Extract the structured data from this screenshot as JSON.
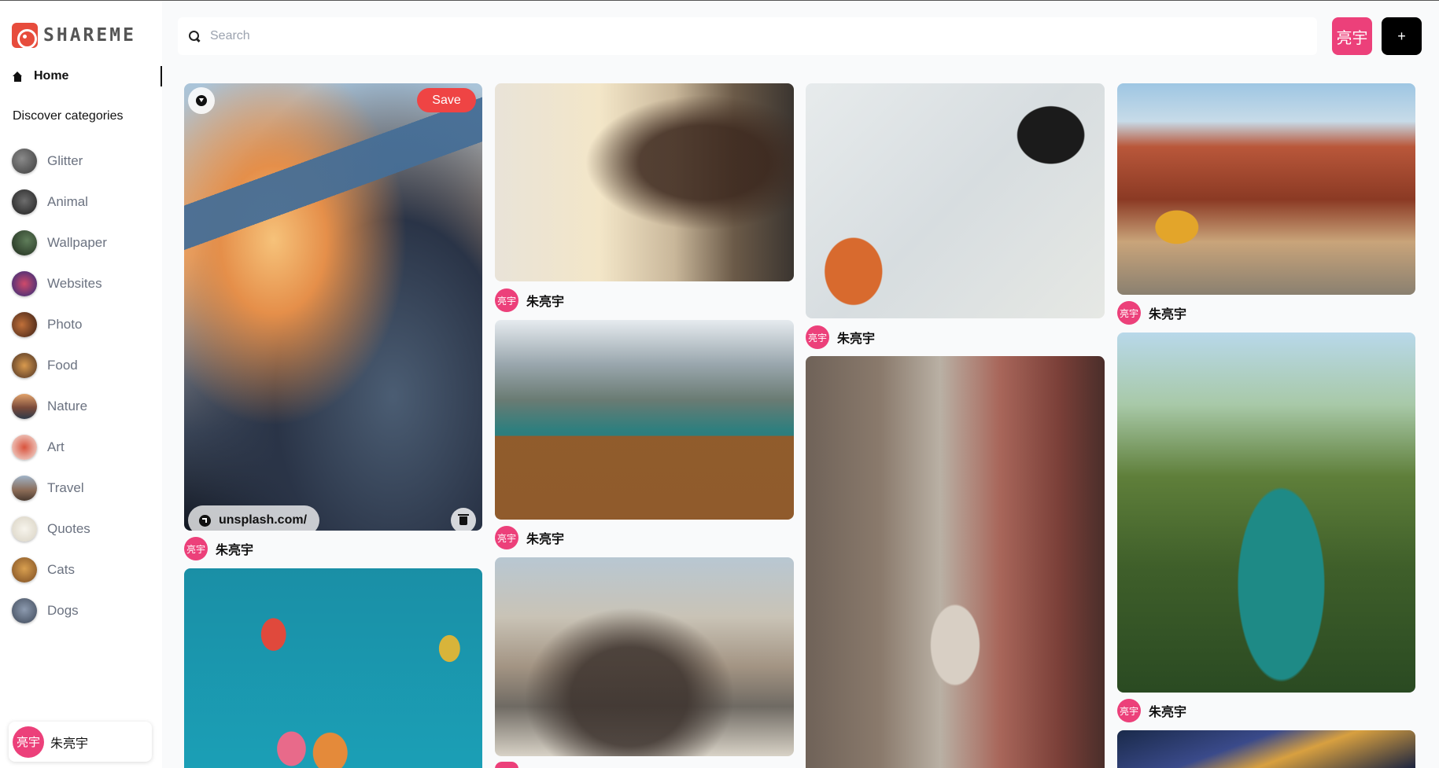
{
  "brand": {
    "name": "SHAREME"
  },
  "nav": {
    "home": "Home",
    "discover": "Discover categories"
  },
  "categories": [
    "Glitter",
    "Animal",
    "Wallpaper",
    "Websites",
    "Photo",
    "Food",
    "Nature",
    "Art",
    "Travel",
    "Quotes",
    "Cats",
    "Dogs"
  ],
  "current_user": {
    "avatar_text": "亮宇",
    "name": "朱亮宇"
  },
  "search": {
    "placeholder": "Search"
  },
  "toolbar": {
    "add_label": "+"
  },
  "pin_actions": {
    "save_label": "Save",
    "source_text": "unsplash.com/"
  },
  "pins": [
    {
      "author_avatar": "亮宇",
      "author": "朱亮宇"
    },
    {
      "author_avatar": "亮宇",
      "author": "朱亮宇"
    },
    {
      "author_avatar": "亮宇",
      "author": "朱亮宇"
    },
    {
      "author_avatar": "亮宇",
      "author": "朱亮宇"
    },
    {
      "author_avatar": "亮宇",
      "author": "朱亮宇"
    },
    {
      "author_avatar": "亮宇",
      "author": "朱亮宇"
    }
  ],
  "colors": {
    "accent": "#ec407a",
    "save": "#ef4444",
    "brand": "#e74c3c"
  }
}
